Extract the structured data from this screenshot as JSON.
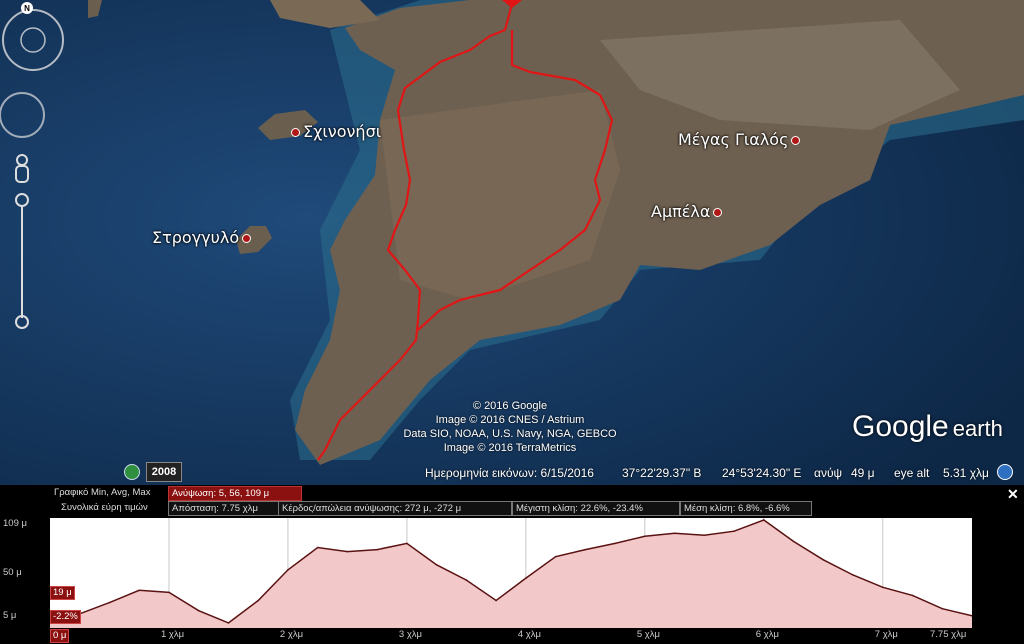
{
  "map": {
    "places": [
      {
        "name": "Σχινονήσι"
      },
      {
        "name": "Στρογγυλό"
      },
      {
        "name": "Μέγας Γιαλός"
      },
      {
        "name": "Αμπέλα"
      }
    ],
    "credits": [
      "© 2016 Google",
      "Image © 2016 CNES / Astrium",
      "Data SIO, NOAA, U.S. Navy, NGA, GEBCO",
      "Image © 2016 TerraMetrics"
    ],
    "logo": {
      "google": "Google",
      "earth": "earth"
    },
    "compass_letter": "N"
  },
  "statusbar": {
    "year": "2008",
    "imagery_date": "Ημερομηνία εικόνων: 6/15/2016",
    "lat": "37°22'29.37\" Β",
    "lon": "24°53'24.30\" Ε",
    "alt_label": "ανύψ",
    "alt_value": "49 μ",
    "eye_alt_label": "eye alt",
    "eye_alt_value": "5.31 χλμ"
  },
  "elevation_panel": {
    "row1_label": "Γραφικό  Min, Avg, Max",
    "row1_selected": "Ανύψωση: 5, 56, 109 μ",
    "row2_label": "Συνολικά εύρη τιμών",
    "row2_distance": "Απόσταση: 7.75 χλμ",
    "row2_gain": "Κέρδος/απώλεια ανύψωσης: 272 μ, -272 μ",
    "row2_max_slope": "Μέγιστη κλίση: 22.6%, -23.4%",
    "row2_avg_slope": "Μέση κλίση: 6.8%, -6.6%",
    "close": "✕",
    "marker_elev": "19 μ",
    "marker_slope": "-2.2%",
    "marker_dist": "0 μ"
  },
  "chart_data": {
    "type": "area",
    "title": "",
    "xlabel": "",
    "ylabel": "",
    "x_tick_labels": [
      "1 χλμ",
      "2 χλμ",
      "3 χλμ",
      "4 χλμ",
      "5 χλμ",
      "6 χλμ",
      "7 χλμ",
      "7.75 χλμ"
    ],
    "y_tick_labels": [
      "109 μ",
      "50 μ",
      "5 μ"
    ],
    "ylim": [
      5,
      109
    ],
    "xlim": [
      0,
      7.75
    ],
    "grid": true,
    "series": [
      {
        "x": [
          0,
          0.25,
          0.5,
          0.75,
          1.0,
          1.25,
          1.5,
          1.75,
          2.0,
          2.25,
          2.5,
          2.75,
          3.0,
          3.25,
          3.5,
          3.75,
          4.0,
          4.25,
          4.5,
          4.75,
          5.0,
          5.25,
          5.5,
          5.75,
          6.0,
          6.25,
          6.5,
          6.75,
          7.0,
          7.25,
          7.5,
          7.75
        ],
        "values": [
          15,
          17,
          28,
          40,
          38,
          20,
          8,
          30,
          60,
          82,
          78,
          80,
          86,
          65,
          50,
          30,
          52,
          73,
          80,
          86,
          93,
          96,
          94,
          98,
          109,
          88,
          70,
          55,
          43,
          35,
          22,
          15
        ]
      }
    ],
    "colors": {
      "line": "#5a1212",
      "fill": "#f2c8c8",
      "route": "#e01616"
    }
  }
}
